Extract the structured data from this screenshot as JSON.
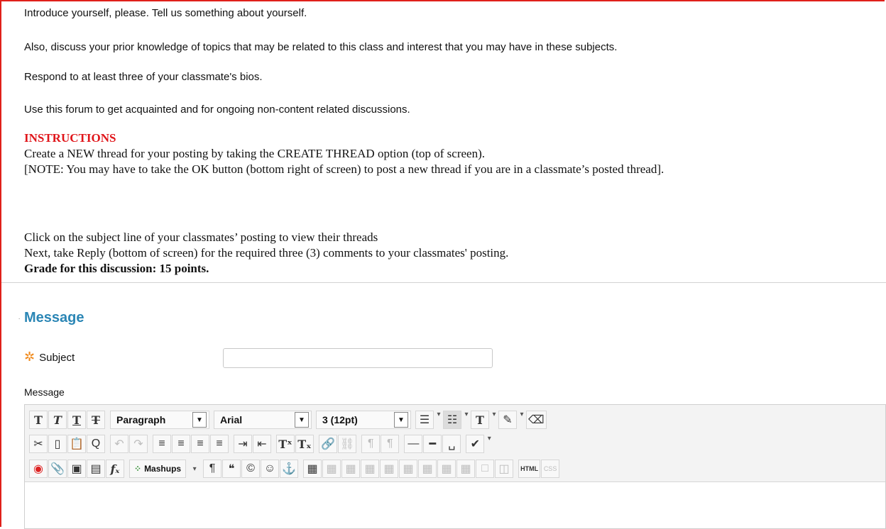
{
  "description": {
    "p1": "Introduce yourself, please. Tell us something about yourself.",
    "p2": "Also, discuss your prior knowledge of topics that may be related to this class and interest that you may have in these subjects.",
    "p3": "Respond to at least three of your classmate's bios.",
    "p4": "Use this forum to get acquainted and for ongoing non-content related discussions.",
    "instructions_heading": "INSTRUCTIONS",
    "instr_line1": "Create a NEW thread for your posting by taking the CREATE THREAD option (top of screen).",
    "instr_line2": "[NOTE: You may have to take the OK button (bottom right of screen) to post a new thread if you are in a classmate’s posted thread].",
    "instr_line3": "Click on the subject line of your classmates’ posting to view their threads",
    "instr_line4": "Next, take Reply (bottom of screen) for the required three (3) comments to your classmates' posting.",
    "grade": "Grade for this discussion: 15 points."
  },
  "form": {
    "section_title": "Message",
    "subject_label": "Subject",
    "subject_value": "",
    "message_label": "Message"
  },
  "toolbar": {
    "paragraph": "Paragraph",
    "font": "Arial",
    "size": "3 (12pt)",
    "mashups": "Mashups",
    "html": "HTML",
    "css": "CSS"
  },
  "colors": {
    "frame": "#e0201a",
    "heading_red": "#e0151a",
    "section_blue": "#2b86b5",
    "required_star": "#f08a1c"
  }
}
